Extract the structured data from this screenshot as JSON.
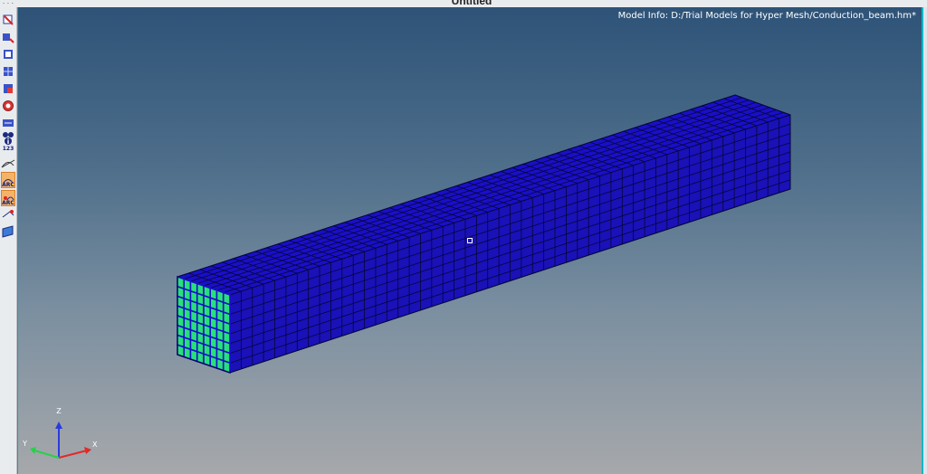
{
  "window": {
    "title": "Untitled"
  },
  "viewport": {
    "model_info": "Model Info: D:/Trial Models for Hyper Mesh/Conduction_beam.hm*",
    "background_top": "#2e5378",
    "background_bottom": "#a6a8ab"
  },
  "mesh": {
    "face_color": "#1a0fc8",
    "edge_color": "#05063a",
    "end_face_highlight": "#28e07a",
    "length_divisions": 50,
    "cross_divisions": 8
  },
  "triad": {
    "x_label": "X",
    "y_label": "Y",
    "z_label": "Z"
  },
  "toolbar": {
    "items": [
      {
        "name": "select-icon"
      },
      {
        "name": "transform-icon"
      },
      {
        "name": "mask-icon"
      },
      {
        "name": "find-icon"
      },
      {
        "name": "isolate-icon"
      },
      {
        "name": "display-icon"
      },
      {
        "name": "reverse-icon"
      },
      {
        "name": "binoculars-icon"
      },
      {
        "name": "info-icon",
        "label": "123"
      },
      {
        "name": "measure-icon"
      },
      {
        "name": "arc-icon",
        "label": "ARC"
      },
      {
        "name": "arc-center-icon",
        "label": "ARC"
      },
      {
        "name": "view-icon"
      },
      {
        "name": "plane-icon"
      }
    ]
  }
}
